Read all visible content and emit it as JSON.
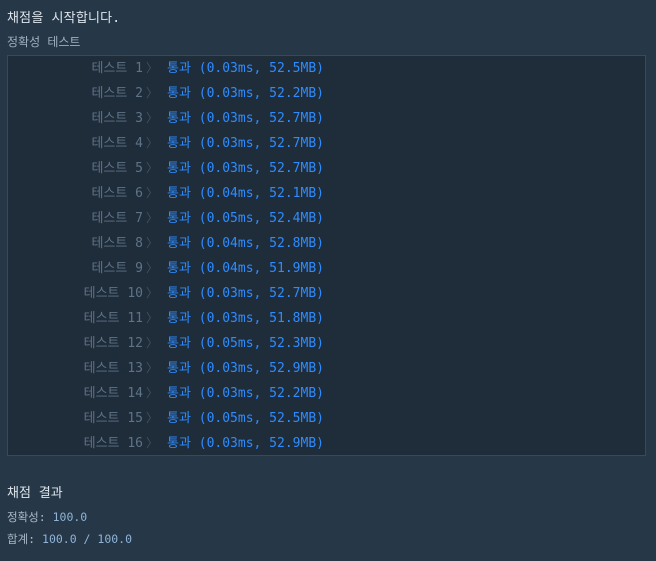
{
  "header": {
    "start_message": "채점을 시작합니다.",
    "section_label": "정확성  테스트"
  },
  "tests": [
    {
      "name": "테스트 1",
      "result": "통과 (0.03ms, 52.5MB)"
    },
    {
      "name": "테스트 2",
      "result": "통과 (0.03ms, 52.2MB)"
    },
    {
      "name": "테스트 3",
      "result": "통과 (0.03ms, 52.7MB)"
    },
    {
      "name": "테스트 4",
      "result": "통과 (0.03ms, 52.7MB)"
    },
    {
      "name": "테스트 5",
      "result": "통과 (0.03ms, 52.7MB)"
    },
    {
      "name": "테스트 6",
      "result": "통과 (0.04ms, 52.1MB)"
    },
    {
      "name": "테스트 7",
      "result": "통과 (0.05ms, 52.4MB)"
    },
    {
      "name": "테스트 8",
      "result": "통과 (0.04ms, 52.8MB)"
    },
    {
      "name": "테스트 9",
      "result": "통과 (0.04ms, 51.9MB)"
    },
    {
      "name": "테스트 10",
      "result": "통과 (0.03ms, 52.7MB)"
    },
    {
      "name": "테스트 11",
      "result": "통과 (0.03ms, 51.8MB)"
    },
    {
      "name": "테스트 12",
      "result": "통과 (0.05ms, 52.3MB)"
    },
    {
      "name": "테스트 13",
      "result": "통과 (0.03ms, 52.9MB)"
    },
    {
      "name": "테스트 14",
      "result": "통과 (0.03ms, 52.2MB)"
    },
    {
      "name": "테스트 15",
      "result": "통과 (0.05ms, 52.5MB)"
    },
    {
      "name": "테스트 16",
      "result": "통과 (0.03ms, 52.9MB)"
    }
  ],
  "summary": {
    "title": "채점 결과",
    "accuracy_label": "정확성: ",
    "accuracy_value": "100.0",
    "total_label": "합계: ",
    "total_value": "100.0 / 100.0"
  },
  "colors": {
    "background": "#263747",
    "panel": "#1f2c3a",
    "pass": "#2e8cff",
    "muted": "#5f7387"
  },
  "icons": {
    "row_separator": "chevron-right-icon"
  }
}
